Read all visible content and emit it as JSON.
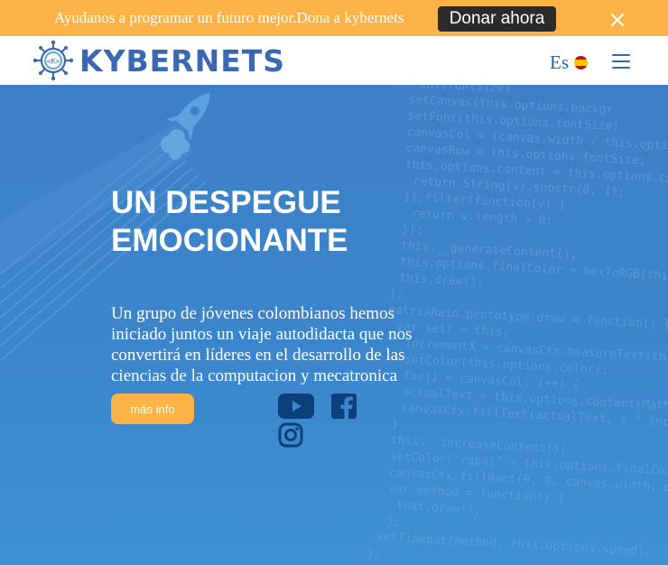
{
  "banner": {
    "text": "Ayudanos a programar un futuro mejor.Dona a kybernets",
    "donate_label": "Donar ahora",
    "close_icon": "close-icon"
  },
  "navbar": {
    "logo_text": "KYBERNETS",
    "logo_badge": "<K>",
    "language": "Es",
    "language_flag": "spain-flag-icon",
    "menu_icon": "hamburger-menu-icon"
  },
  "hero": {
    "title": "UN DESPEGUE EMOCIONANTE",
    "description": "Un grupo de jóvenes colombianos hemos iniciado juntos un viaje autodidacta que nos convertirá en líderes en el desarrollo de las ciencias de la computacion y mecatronica",
    "button_label": "más info",
    "social_icons": [
      "youtube-icon",
      "facebook-icon",
      "instagram-icon"
    ]
  },
  "colors": {
    "banner_bg": "#fbb347",
    "donate_bg": "#2b2b2b",
    "brand_blue": "#3a68b3",
    "hero_bg": "#3b83c9",
    "accent": "#fbb347"
  }
}
